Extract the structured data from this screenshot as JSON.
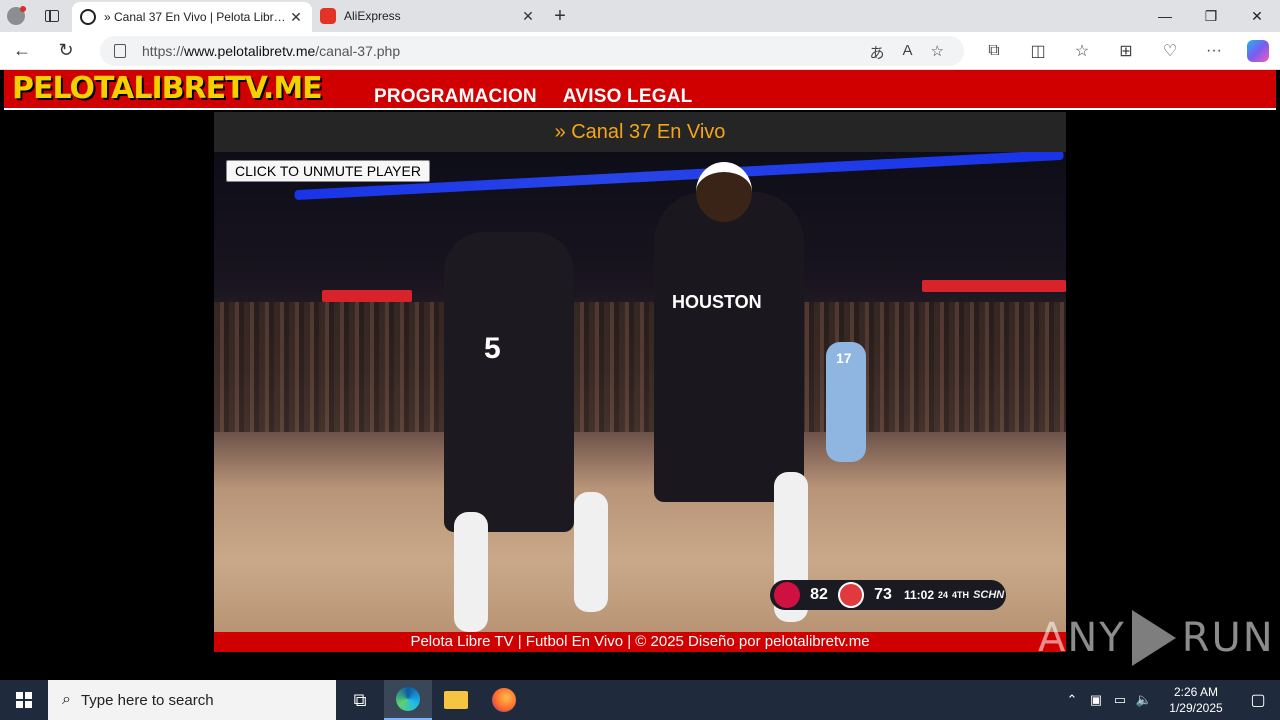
{
  "browser": {
    "tabs": [
      {
        "title": "» Canal 37 En Vivo | Pelota Libre TV",
        "favicon": "soccer-ball-icon",
        "active": true
      },
      {
        "title": "AliExpress",
        "favicon": "aliexpress-icon",
        "active": false
      }
    ],
    "new_tab_symbol": "+",
    "close_symbol": "✕",
    "window_controls": {
      "minimize": "—",
      "restore": "❐",
      "close": "✕"
    },
    "nav": {
      "back": "←",
      "reload": "↻"
    },
    "url_prefix": "https://",
    "url_host": "www.pelotalibretv.me",
    "url_path": "/canal-37.php",
    "url_icons": {
      "translate": "あ",
      "read_aloud": "A",
      "favorite": "☆"
    },
    "toolbar": {
      "extensions": "⧉",
      "split": "◫",
      "favorites": "☆",
      "collections": "⊞",
      "performance": "♡",
      "more": "···"
    }
  },
  "site": {
    "logo": "PELOTALIBRETV.ME",
    "nav": [
      "PROGRAMACION",
      "AVISO LEGAL"
    ],
    "channel_title": "» Canal 37 En Vivo",
    "unmute_button": "CLICK TO UNMUTE PLAYER",
    "footer": "Pelota Libre TV | Futbol En Vivo | © 2025 Diseño por pelotalibretv.me"
  },
  "video": {
    "jersey_text": "HOUSTON",
    "player_number_left": "5",
    "player_number_right": "17",
    "scoreboard": {
      "home_score": "82",
      "away_score": "73",
      "clock": "11:02",
      "shot_clock": "24",
      "quarter": "4TH",
      "network": "SCHN"
    }
  },
  "watermark": {
    "left": "ANY",
    "right": "RUN"
  },
  "taskbar": {
    "search_placeholder": "Type here to search",
    "time": "2:26 AM",
    "date": "1/29/2025"
  },
  "colors": {
    "site_red": "#d10000",
    "logo_yellow": "#f5d000",
    "channel_title_orange": "#f5a41a"
  }
}
